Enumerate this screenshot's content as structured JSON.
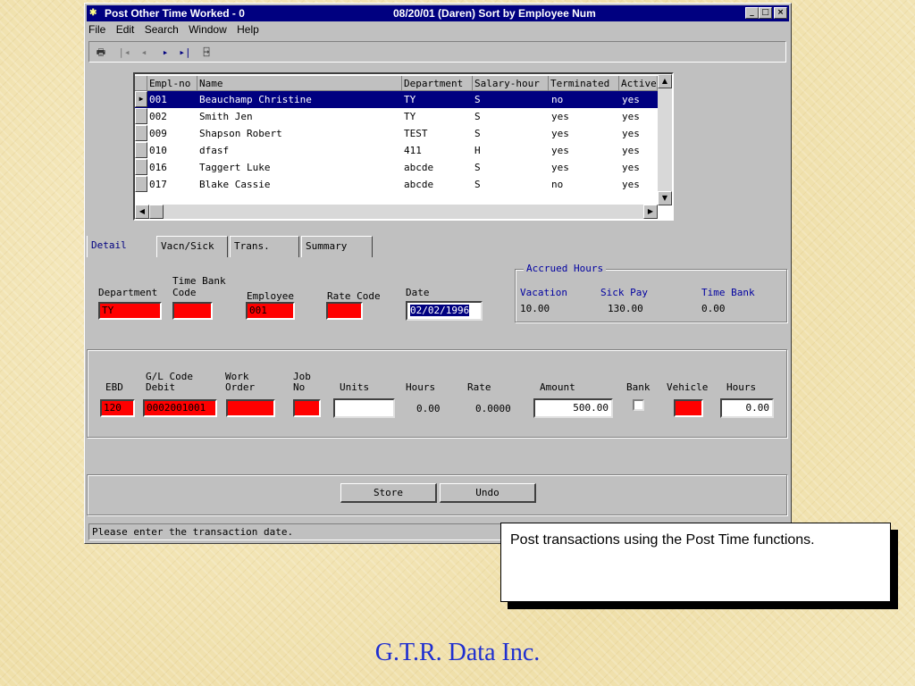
{
  "window": {
    "title_left": "Post Other Time Worked - 0",
    "title_right": "08/20/01 (Daren) Sort by Employee Num",
    "controls": {
      "minimize": "_",
      "maximize": "□",
      "close": "×"
    }
  },
  "menu": [
    "File",
    "Edit",
    "Search",
    "Window",
    "Help"
  ],
  "toolbar": {
    "icons": [
      "printer-icon",
      "first-record-icon",
      "previous-record-icon",
      "next-record-icon",
      "last-record-icon",
      "exit-door-icon"
    ]
  },
  "grid": {
    "columns": [
      "Empl-no",
      "Name",
      "Department",
      "Salary-hour",
      "Terminated",
      "Active"
    ],
    "rows": [
      {
        "empl": "001",
        "name": "Beauchamp Christine",
        "dept": "TY",
        "sal": "S",
        "term": "no",
        "active": "yes"
      },
      {
        "empl": "002",
        "name": "Smith Jen",
        "dept": "TY",
        "sal": "S",
        "term": "yes",
        "active": "yes"
      },
      {
        "empl": "009",
        "name": "Shapson Robert",
        "dept": "TEST",
        "sal": "S",
        "term": "yes",
        "active": "yes"
      },
      {
        "empl": "010",
        "name": "dfasf",
        "dept": "411",
        "sal": "H",
        "term": "yes",
        "active": "yes"
      },
      {
        "empl": "016",
        "name": "Taggert Luke",
        "dept": "abcde",
        "sal": "S",
        "term": "yes",
        "active": "yes"
      },
      {
        "empl": "017",
        "name": "Blake Cassie",
        "dept": "abcde",
        "sal": "S",
        "term": "no",
        "active": "yes"
      }
    ]
  },
  "tabs": [
    "Detail",
    "Vacn/Sick",
    "Trans.",
    "Summary"
  ],
  "detail": {
    "labels": {
      "department": "Department",
      "time_bank_1": "Time Bank",
      "time_bank_2": "Code",
      "employee": "Employee",
      "rate_code": "Rate Code",
      "date": "Date"
    },
    "values": {
      "department": "TY",
      "time_bank_code": "",
      "employee": "001",
      "rate_code": "",
      "date": "02/02/1996"
    },
    "accrued": {
      "title": "Accrued Hours",
      "labels": [
        "Vacation",
        "Sick Pay",
        "Time Bank"
      ],
      "values": [
        "10.00",
        "130.00",
        "0.00"
      ]
    }
  },
  "trans": {
    "labels": {
      "ebd": "EBD",
      "gl_1": "G/L Code",
      "gl_2": "Debit",
      "wo_1": "Work",
      "wo_2": "Order",
      "job_1": "Job",
      "job_2": "No",
      "units": "Units",
      "hours": "Hours",
      "rate": "Rate",
      "amount": "Amount",
      "bank": "Bank",
      "vehicle": "Vehicle",
      "hours2": "Hours"
    },
    "values": {
      "ebd": "120",
      "gl_code": "0002001001",
      "work_order": "",
      "job_no": "",
      "units": "",
      "hours": "0.00",
      "rate": "0.0000",
      "amount": "500.00",
      "bank_checked": false,
      "vehicle": "",
      "hours2": "0.00"
    }
  },
  "buttons": {
    "store": "Store",
    "undo": "Undo"
  },
  "status": "Please enter the transaction date.",
  "callout": "Post transactions using the Post Time functions.",
  "footer": "G.T.R. Data Inc.",
  "colors": {
    "titlebar": "#000080",
    "required_field": "#ff0000",
    "footer_text": "#1f2fd0"
  }
}
